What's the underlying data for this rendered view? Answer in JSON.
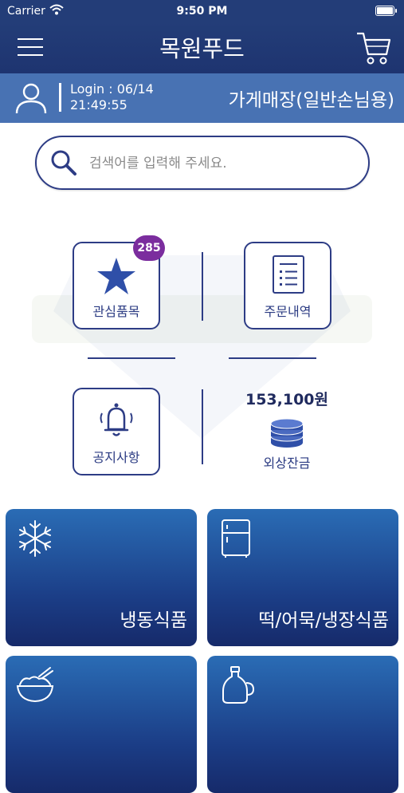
{
  "status": {
    "carrier": "Carrier",
    "time": "9:50 PM"
  },
  "nav": {
    "title": "목원푸드",
    "menu_icon": "hamburger-menu-icon",
    "cart_icon": "shopping-cart-icon"
  },
  "user": {
    "login_line1": "Login : 06/14",
    "login_line2": "21:49:55",
    "store_name": "가게매장(일반손님용)"
  },
  "search": {
    "placeholder": "검색어를 입력해 주세요.",
    "value": ""
  },
  "menu": {
    "favorites": {
      "label": "관심품목",
      "badge": "285"
    },
    "orders": {
      "label": "주문내역"
    },
    "notices": {
      "label": "공지사항"
    },
    "balance": {
      "amount": "153,100원",
      "label": "외상잔금"
    }
  },
  "categories": [
    {
      "label": "냉동식품",
      "icon": "snowflake-icon"
    },
    {
      "label": "떡/어묵/냉장식품",
      "icon": "refrigerator-icon"
    },
    {
      "label": "",
      "icon": "rice-bowl-icon"
    },
    {
      "label": "",
      "icon": "oil-bottle-icon"
    }
  ],
  "colors": {
    "header": "#233d78",
    "userbar": "#4872b3",
    "accent": "#2d3c85",
    "badge": "#7b2d9e"
  }
}
